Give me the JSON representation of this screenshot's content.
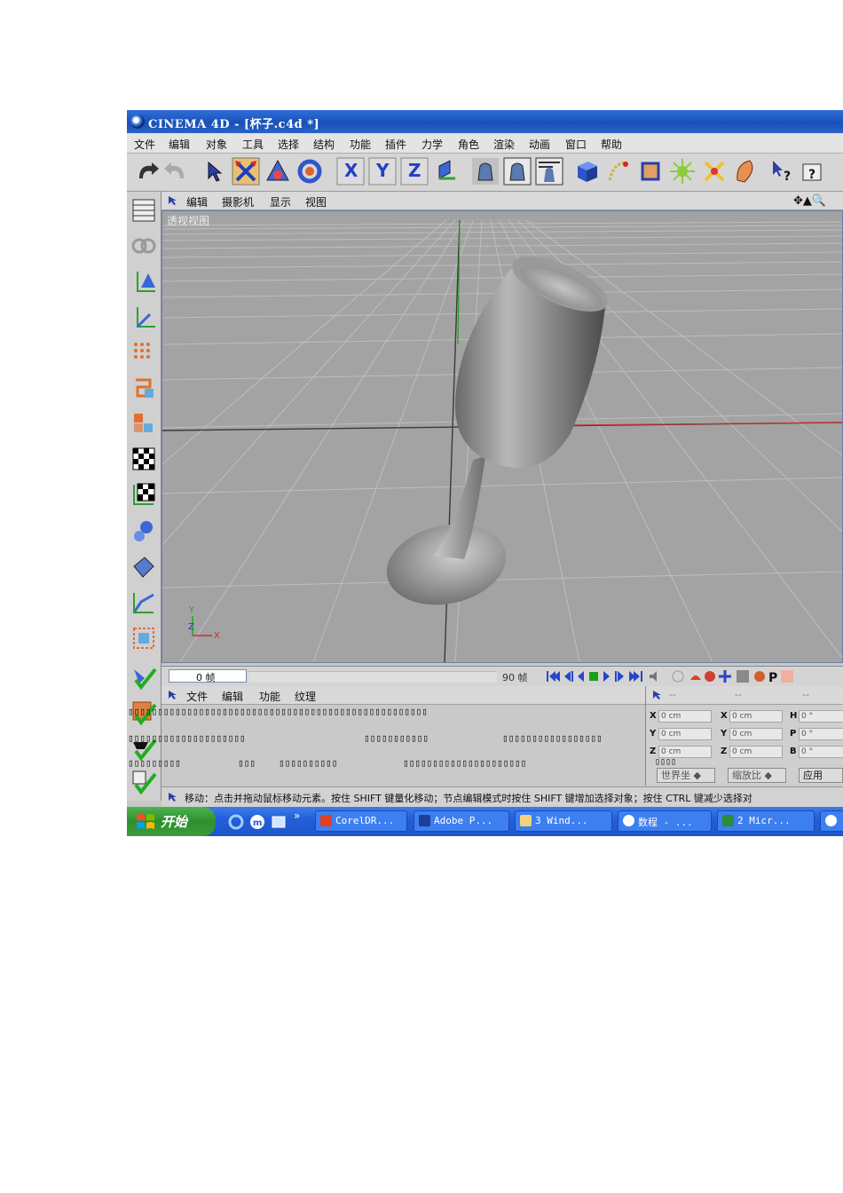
{
  "window": {
    "title": "CINEMA 4D - [杯子.c4d *]"
  },
  "menu": [
    "文件",
    "编辑",
    "对象",
    "工具",
    "选择",
    "结构",
    "功能",
    "插件",
    "力学",
    "角色",
    "渲染",
    "动画",
    "窗口",
    "帮助"
  ],
  "viewport": {
    "menu": [
      "编辑",
      "摄影机",
      "显示",
      "视图"
    ],
    "label": "透视视图",
    "nav_icons": "✥▲🔍",
    "axis_z": "Z",
    "axis_y": "Y",
    "axis_x": "X"
  },
  "timeline": {
    "current_frame": "0 帧",
    "end_frame": "90 帧"
  },
  "materials": {
    "menu": [
      "文件",
      "编辑",
      "功能",
      "纹理"
    ],
    "garbled_1": "▯▯▯▯▯▯▯▯▯▯▯▯▯▯▯▯▯▯▯▯▯▯▯▯▯▯▯▯▯▯▯▯▯▯▯▯▯▯▯▯▯▯▯▯▯▯▯▯▯▯▯",
    "garbled_2a": "▯▯▯▯▯▯▯▯▯▯▯▯▯▯▯▯▯▯▯▯",
    "garbled_2b": "▯▯▯▯▯▯▯▯▯▯▯",
    "garbled_2c": "▯▯▯▯▯▯▯▯▯▯▯▯▯▯▯▯▯",
    "garbled_3a": "▯▯▯▯▯▯▯▯▯",
    "garbled_3b": "▯▯▯",
    "garbled_3c": "▯▯▯▯▯▯▯▯▯▯",
    "garbled_3d": "▯▯▯▯▯▯▯▯▯▯▯▯▯▯▯▯▯▯▯▯▯"
  },
  "coordinates": {
    "headers": [
      "--",
      "--",
      "--"
    ],
    "rows": [
      {
        "a": "X",
        "av": "0 cm",
        "b": "X",
        "bv": "0 cm",
        "c": "H",
        "cv": "0 °"
      },
      {
        "a": "Y",
        "av": "0 cm",
        "b": "Y",
        "bv": "0 cm",
        "c": "P",
        "cv": "0 °"
      },
      {
        "a": "Z",
        "av": "0 cm",
        "b": "Z",
        "bv": "0 cm",
        "c": "B",
        "cv": "0 °"
      }
    ],
    "garbled": "▯▯▯▯",
    "mode_world": "世界坐",
    "mode_scale": "缩放比",
    "apply": "应用"
  },
  "status": {
    "text": "移动：点击并拖动鼠标移动元素。按住 SHIFT 键量化移动；节点编辑模式时按住 SHIFT 键增加选择对象；按住 CTRL 键减少选择对"
  },
  "taskbar": {
    "start": "开始",
    "chevron": "»",
    "tasks": [
      "CorelDR...",
      "Adobe P...",
      "3 Wind...",
      "数程 - ...",
      "2 Micr..."
    ]
  },
  "colors": {
    "accent": "#245edb",
    "viewport_bg": "#a3a3a3",
    "grid": "#bdbdbd"
  }
}
